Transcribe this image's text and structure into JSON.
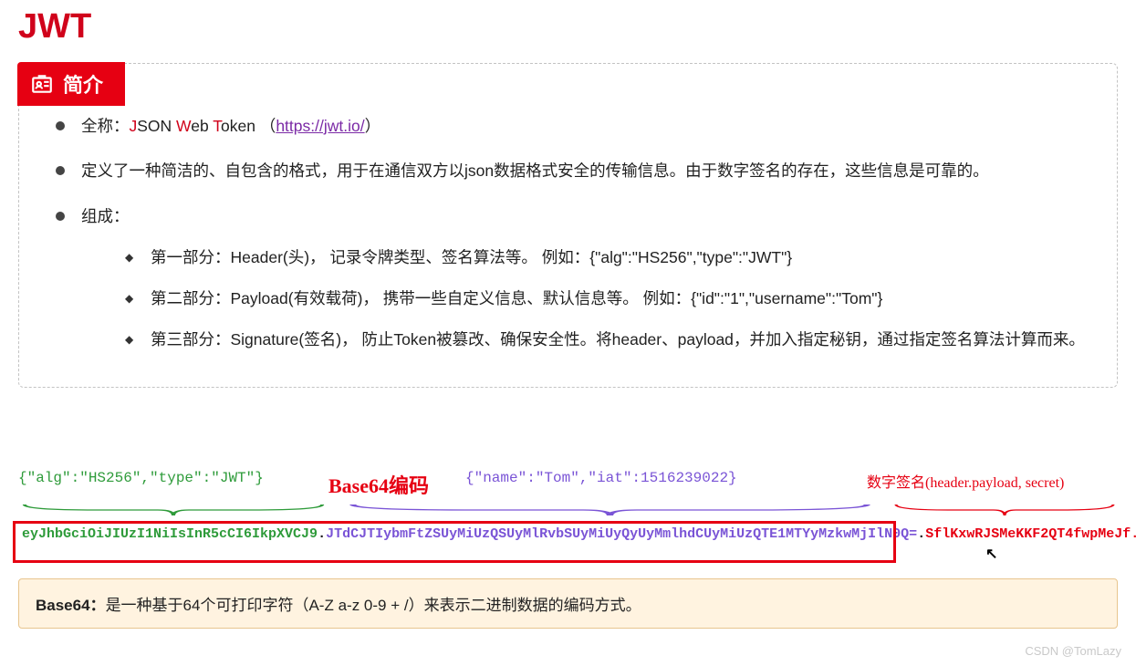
{
  "title": "JWT",
  "badge": "简介",
  "fullname": {
    "prefix": "全称：",
    "J": "J",
    "SON": "SON ",
    "W": "W",
    "eb": "eb ",
    "T": "T",
    "oken": "oken （",
    "link": "https://jwt.io/",
    "close": "）"
  },
  "definition": "定义了一种简洁的、自包含的格式，用于在通信双方以json数据格式安全的传输信息。由于数字签名的存在，这些信息是可靠的。",
  "composition_title": "组成：",
  "parts": [
    "第一部分：Header(头)， 记录令牌类型、签名算法等。 例如：{\"alg\":\"HS256\",\"type\":\"JWT\"}",
    "第二部分：Payload(有效载荷)， 携带一些自定义信息、默认信息等。 例如：{\"id\":\"1\",\"username\":\"Tom\"}",
    "第三部分：Signature(签名)， 防止Token被篡改、确保安全性。将header、payload，并加入指定秘钥，通过指定签名算法计算而来。"
  ],
  "labels": {
    "header_json": "{\"alg\":\"HS256\",\"type\":\"JWT\"}",
    "base64": "Base64编码",
    "payload_json": "{\"name\":\"Tom\",\"iat\":1516239022}",
    "signature": "数字签名(header.payload, secret)"
  },
  "token": {
    "header": "eyJhbGciOiJIUzI1NiIsInR5cCI6IkpXVCJ9",
    "dot": ".",
    "payload": "JTdCJTIybmFtZSUyMiUzQSUyMlRvbSUyMiUyQyUyMmlhdCUyMiUzQTE1MTYyMzkwMjIlN0Q=",
    "signature": "SflKxwRJSMeKKF2QT4fwpMeJf..."
  },
  "note": {
    "label": "Base64：",
    "text": "是一种基于64个可打印字符（A-Z a-z 0-9 + /）来表示二进制数据的编码方式。"
  },
  "watermark": "CSDN @TomLazy"
}
